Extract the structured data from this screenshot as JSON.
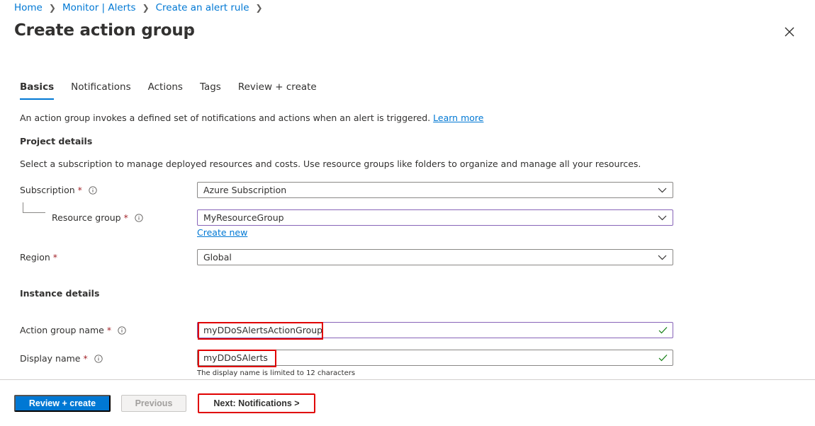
{
  "breadcrumb": {
    "items": [
      "Home",
      "Monitor | Alerts",
      "Create an alert rule"
    ]
  },
  "header": {
    "title": "Create action group",
    "more": "···"
  },
  "tabs": [
    {
      "label": "Basics"
    },
    {
      "label": "Notifications"
    },
    {
      "label": "Actions"
    },
    {
      "label": "Tags"
    },
    {
      "label": "Review + create"
    }
  ],
  "intro": {
    "text": "An action group invokes a defined set of notifications and actions when an alert is triggered.",
    "link": "Learn more"
  },
  "project": {
    "title": "Project details",
    "description": "Select a subscription to manage deployed resources and costs. Use resource groups like folders to organize and manage all your resources.",
    "subscription_label": "Subscription",
    "subscription_value": "Azure Subscription",
    "resource_group_label": "Resource group",
    "resource_group_value": "MyResourceGroup",
    "create_new": "Create new",
    "region_label": "Region",
    "region_value": "Global"
  },
  "instance": {
    "title": "Instance details",
    "action_group_name_label": "Action group name",
    "action_group_name_value": "myDDoSAlertsActionGroup",
    "display_name_label": "Display name",
    "display_name_value": "myDDoSAlerts",
    "display_name_hint": "The display name is limited to 12 characters"
  },
  "required_marker": "*",
  "footer": {
    "review_create": "Review + create",
    "previous": "Previous",
    "next": "Next: Notifications >"
  },
  "colors": {
    "accent": "#0078d4",
    "highlight": "#e00000",
    "required": "#a4262c",
    "valid": "#107c10"
  }
}
